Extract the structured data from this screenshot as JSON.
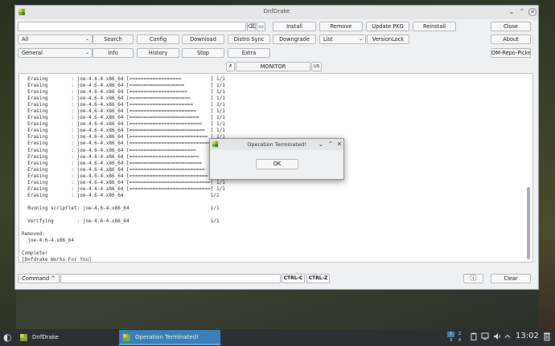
{
  "window": {
    "title": "DnfDrake",
    "min": "⌄",
    "max": "⌃",
    "close": "✕"
  },
  "toolbar": {
    "backspace_icon": "⌫",
    "folder_icon": "▭",
    "install": "Install",
    "remove": "Remove",
    "update_pkg": "Update PKG",
    "reinstall": "Reinstall",
    "close": "Close",
    "filter_all": "All",
    "search": "Search",
    "config": "Config",
    "download": "Download",
    "distro_sync": "Distro Sync",
    "downgrade": "Downgrade",
    "list": "List",
    "versionlock": "VersionLock",
    "about": "About",
    "group_general": "General",
    "info": "Info",
    "history": "History",
    "stop": "Stop",
    "extra": "Extra",
    "om_repo_picker": "OM-Repo-Picker",
    "pin_icon": "✗",
    "monitor": "MONITOR",
    "lang": "US"
  },
  "output": {
    "lines": [
      "  Erasing        : joe-4.6-4.x86_64 [==================          ] 1/1",
      "  Erasing        : joe-4.6-4.x86_64 [===================         ] 1/1",
      "  Erasing        : joe-4.6-4.x86_64 [====================        ] 1/1",
      "  Erasing        : joe-4.6-4.x86_64 [=====================       ] 1/1",
      "  Erasing        : joe-4.6-4.x86_64 [======================      ] 1/1",
      "  Erasing        : joe-4.6-4.x86_64 [=======================     ] 1/1",
      "  Erasing        : joe-4.6-4.x86_64 [========================    ] 1/1",
      "  Erasing        : joe-4.6-4.x86_64 [=========================   ] 1/1",
      "  Erasing        : joe-4.6-4.x86_64 [==========================  ] 1/1",
      "  Erasing        : joe-4.6-4.x86_64 [=========================== ] 1/1",
      "  Erasing        : joe-4.6-4.x86_64 [============================] 1/1",
      "  Erasing        : joe-4.6-4.x86_64 [=======================     ] 1/1",
      "  Erasing        : joe-4.6-4.x86_64 [========================    ] 1/1",
      "  Erasing        : joe-4.6-4.x86_64 [=========================   ] 1/1",
      "  Erasing        : joe-4.6-4.x86_64 [==========================  ] 1/1",
      "  Erasing        : joe-4.6-4.x86_64 [=========================== ] 1/1",
      "  Erasing        : joe-4.6-4.x86_64 [============================] 1/1",
      "  Erasing        : joe-4.6-4.x86_64 [============================] 1/1",
      "  Erasing        : joe-4.6-4.x86_64                              1/1",
      "",
      "  Running scriptlet: joe-4.6-4.x86_64                            1/1",
      "",
      "  Verifying        : joe-4.6-4.x86_64                            1/1",
      "",
      "Removed:",
      "  joe-4.6-4.x86_64",
      "",
      "Complete!",
      "[Dnfdrake Works For You]"
    ]
  },
  "bottom": {
    "command": "Command ^",
    "ctrl_c": "CTRL-C",
    "ctrl_z": "CTRL-Z",
    "info_icon": "ⓘ",
    "clear": "Clear"
  },
  "dialog": {
    "title": "Operation Terminated!",
    "ok": "OK",
    "min": "⌄",
    "max": "⌃",
    "close": "✕"
  },
  "taskbar": {
    "start_icon": "◐",
    "task1": "DnfDrake",
    "task2": "Operation Terminated!",
    "pager": [
      "1",
      "2",
      "3",
      "4"
    ],
    "time": "13:02"
  }
}
